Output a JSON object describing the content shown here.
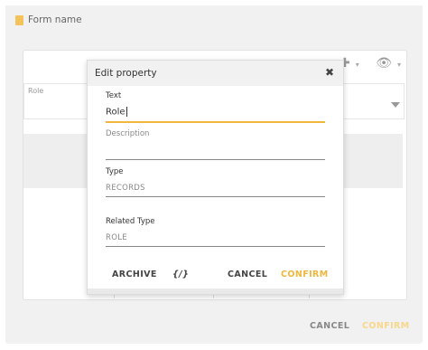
{
  "form": {
    "title": "Form name"
  },
  "background_form": {
    "role_label": "Role"
  },
  "outer_actions": {
    "cancel": "CANCEL",
    "confirm": "CONFIRM"
  },
  "modal": {
    "title": "Edit property",
    "close": "✖",
    "fields": {
      "text": {
        "label": "Text",
        "value": "Role"
      },
      "description": {
        "label": "Description",
        "value": ""
      },
      "type": {
        "label": "Type",
        "value": "RECORDS"
      },
      "related_type": {
        "label": "Related Type",
        "value": "ROLE"
      }
    },
    "actions": {
      "archive": "ARCHIVE",
      "code": "{/}",
      "cancel": "CANCEL",
      "confirm": "CONFIRM"
    }
  },
  "colors": {
    "accent": "#f0b73c",
    "accent_muted": "#f7d78a"
  },
  "icons": {
    "add": "plus-icon",
    "view": "eye-icon",
    "doc": "document-icon"
  }
}
